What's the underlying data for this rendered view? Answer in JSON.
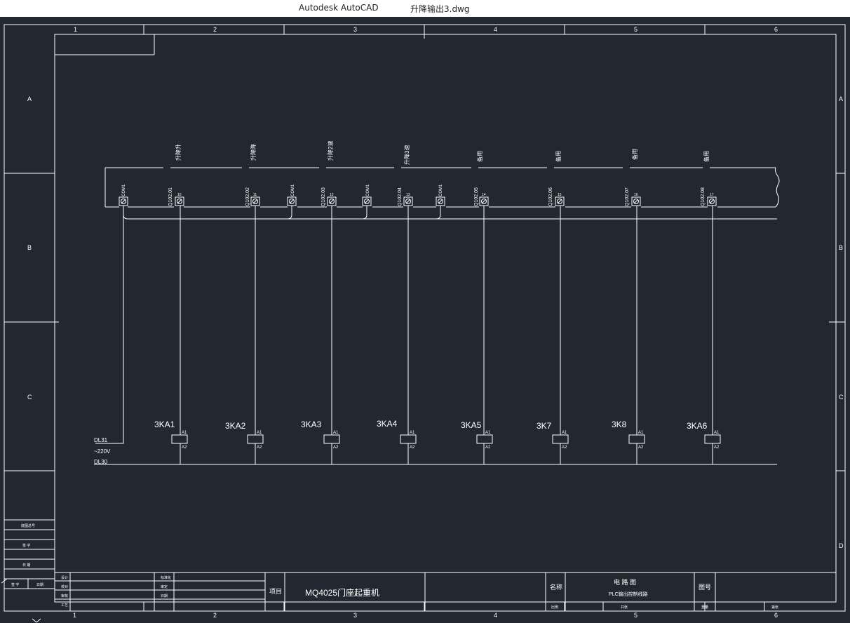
{
  "window": {
    "app_name": "Autodesk AutoCAD",
    "file_name": "升降输出3.dwg"
  },
  "colors": {
    "canvas": "#212830",
    "line": "#ffffff"
  },
  "border": {
    "col_numbers": [
      "1",
      "2",
      "3",
      "4",
      "5",
      "6"
    ],
    "row_letters": [
      "A",
      "B",
      "C",
      "D"
    ]
  },
  "circuit": {
    "top_notes": [
      "升降升",
      "升降降",
      "升降2速",
      "升降3速",
      "备用",
      "备用",
      "备用",
      "备用"
    ],
    "com_labels": [
      "COM1",
      "COM1",
      "COM1",
      "COM1"
    ],
    "address_labels": [
      "Q102.01",
      "Q102.02",
      "Q102.03",
      "Q102.04",
      "Q102.05",
      "Q102.06",
      "Q102.07",
      "Q102.08"
    ],
    "terminal_numbers": [
      "10",
      "11",
      "12",
      "13",
      "14",
      "15",
      "16",
      "17"
    ],
    "coils": [
      "3KA1",
      "3KA2",
      "3KA3",
      "3KA4",
      "3KA5",
      "3K7",
      "3K8",
      "3KA6"
    ],
    "coil_pin_top": "A1",
    "coil_pin_bottom": "A2",
    "power": {
      "line_top": "DL31",
      "voltage": "~220V",
      "line_bottom": "DL30"
    }
  },
  "side_table": [
    "底图总号",
    "签  字",
    "日  期",
    "日期"
  ],
  "title_block": {
    "sign_labels": [
      "设计",
      "校对",
      "审核",
      "工艺"
    ],
    "sign_labels_2": [
      "标准化",
      "审定",
      "日期"
    ],
    "project_label": "项目",
    "project_value": "MQ4025门座起重机",
    "name_label": "名称",
    "drawing_title": "电 路 图",
    "drawing_subtitle": "PLC输出控制线路",
    "drawing_no_label": "图号",
    "bottom_labels": [
      "比例",
      "共张",
      "重量",
      "第张"
    ]
  }
}
